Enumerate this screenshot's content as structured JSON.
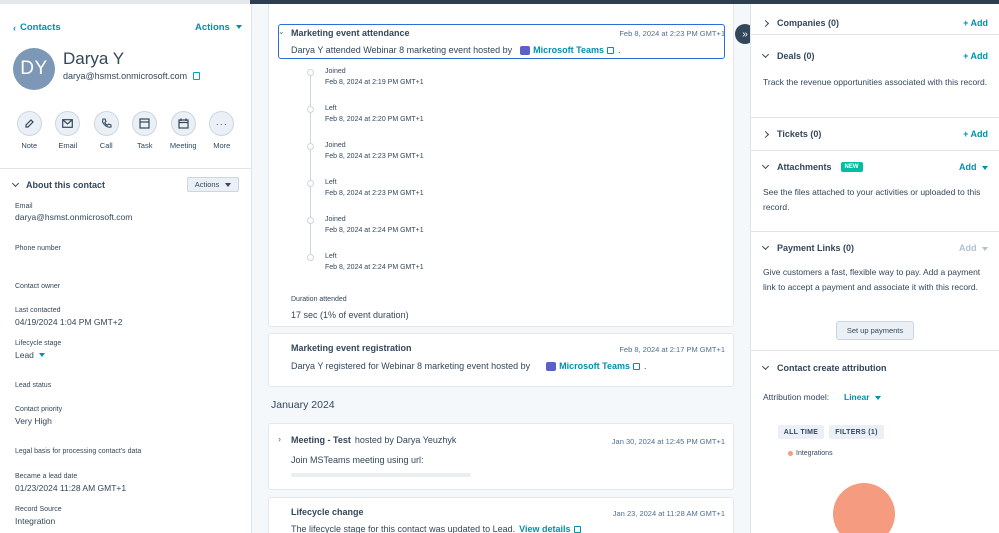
{
  "left": {
    "back_link": "Contacts",
    "actions": "Actions",
    "avatar_initials": "DY",
    "name": "Darya Y",
    "email": "darya@hsmst.onmicrosoft.com",
    "quick_actions": [
      {
        "label": "Note",
        "icon": "note-icon"
      },
      {
        "label": "Email",
        "icon": "email-icon"
      },
      {
        "label": "Call",
        "icon": "phone-icon"
      },
      {
        "label": "Task",
        "icon": "task-icon"
      },
      {
        "label": "Meeting",
        "icon": "calendar-icon"
      },
      {
        "label": "More",
        "icon": "more-icon"
      }
    ],
    "about_title": "About this contact",
    "about_actions": "Actions",
    "props": {
      "email_label": "Email",
      "email_value": "darya@hsmst.onmicrosoft.com",
      "phone_label": "Phone number",
      "owner_label": "Contact owner",
      "last_contacted_label": "Last contacted",
      "last_contacted_value": "04/19/2024 1:04 PM GMT+2",
      "lifecycle_label": "Lifecycle stage",
      "lifecycle_value": "Lead",
      "lead_status_label": "Lead status",
      "priority_label": "Contact priority",
      "priority_value": "Very High",
      "legal_label": "Legal basis for processing contact's data",
      "became_lead_label": "Became a lead date",
      "became_lead_value": "01/23/2024 11:28 AM GMT+1",
      "record_source_label": "Record Source",
      "record_source_value": "Integration"
    }
  },
  "middle": {
    "attendance": {
      "title": "Marketing event attendance",
      "date": "Feb 8, 2024 at 2:23 PM GMT+1",
      "text": "Darya Y attended Webinar 8 marketing event hosted by",
      "teams": "Microsoft Teams",
      "timeline": [
        {
          "action": "Joined",
          "time": "Feb 8, 2024 at 2:19 PM GMT+1"
        },
        {
          "action": "Left",
          "time": "Feb 8, 2024 at 2:20 PM GMT+1"
        },
        {
          "action": "Joined",
          "time": "Feb 8, 2024 at 2:23 PM GMT+1"
        },
        {
          "action": "Left",
          "time": "Feb 8, 2024 at 2:23 PM GMT+1"
        },
        {
          "action": "Joined",
          "time": "Feb 8, 2024 at 2:24 PM GMT+1"
        },
        {
          "action": "Left",
          "time": "Feb 8, 2024 at 2:24 PM GMT+1"
        }
      ],
      "duration_label": "Duration attended",
      "duration_value": "17 sec (1% of event duration)"
    },
    "registration": {
      "title": "Marketing event registration",
      "date": "Feb 8, 2024 at 2:17 PM GMT+1",
      "text": "Darya Y registered for Webinar 8 marketing event hosted by",
      "teams": "Microsoft Teams"
    },
    "month": "January 2024",
    "meeting": {
      "title": "Meeting - Test",
      "hosted": "hosted by Darya Yeuzhyk",
      "date": "Jan 30, 2024 at 12:45 PM GMT+1",
      "text": "Join MSTeams meeting using url:"
    },
    "lifecycle": {
      "title": "Lifecycle change",
      "date": "Jan 23, 2024 at 11:28 AM GMT+1",
      "text": "The lifecycle stage for this contact was updated to Lead.",
      "link": "View details"
    }
  },
  "right": {
    "companies": {
      "title": "Companies (0)",
      "add": "+ Add"
    },
    "deals": {
      "title": "Deals (0)",
      "add": "+ Add",
      "text": "Track the revenue opportunities associated with this record."
    },
    "tickets": {
      "title": "Tickets (0)",
      "add": "+ Add"
    },
    "attachments": {
      "title": "Attachments",
      "badge": "NEW",
      "add": "Add",
      "text": "See the files attached to your activities or uploaded to this record."
    },
    "payment": {
      "title": "Payment Links (0)",
      "add": "Add",
      "text": "Give customers a fast, flexible way to pay. Add a payment link to accept a payment and associate it with this record.",
      "button": "Set up payments"
    },
    "attribution": {
      "title": "Contact create attribution",
      "model_label": "Attribution model:",
      "model_value": "Linear",
      "all_time": "ALL TIME",
      "filters": "FILTERS (1)",
      "legend": "Integrations",
      "legend_color": "#f59b7f"
    }
  }
}
